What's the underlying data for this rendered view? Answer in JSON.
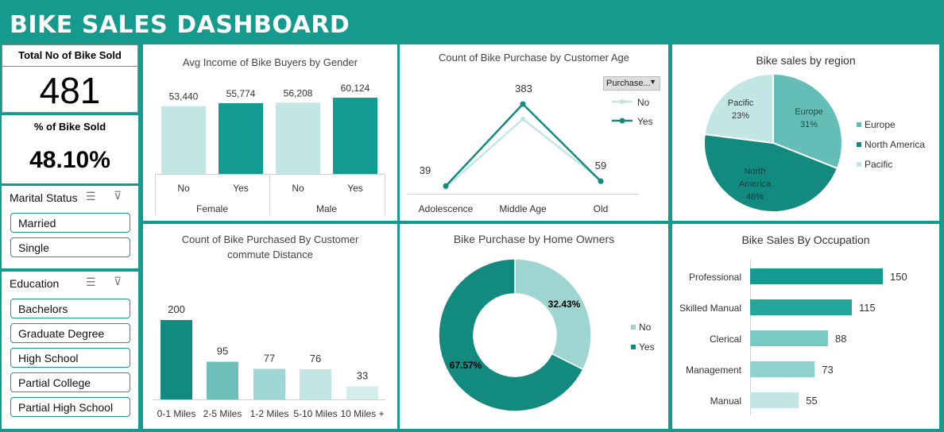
{
  "dashboard": {
    "title": "BIKE SALES DASHBOARD"
  },
  "kpis": {
    "total_label": "Total No of Bike Sold",
    "total_value": "481",
    "pct_label": "% of Bike Sold",
    "pct_value": "48.10%"
  },
  "slicers": {
    "marital": {
      "title": "Marital Status",
      "items": [
        "Married",
        "Single"
      ]
    },
    "education": {
      "title": "Education",
      "items": [
        "Bachelors",
        "Graduate Degree",
        "High School",
        "Partial College",
        "Partial High School"
      ]
    }
  },
  "colors": {
    "dark": "#138a80",
    "mid": "#79c6c1",
    "light": "#c2e6e4",
    "bg": "#159a8e"
  },
  "chart_data": [
    {
      "id": "income_gender",
      "type": "bar",
      "title": "Avg Income of Bike Buyers by  Gender",
      "groups": [
        "Female",
        "Male"
      ],
      "categories": [
        "No",
        "Yes",
        "No",
        "Yes"
      ],
      "values": [
        53440,
        55774,
        56208,
        60124
      ],
      "labels": [
        "53,440",
        "55,774",
        "56,208",
        "60,124"
      ]
    },
    {
      "id": "age",
      "type": "line",
      "title": "Count of Bike Purchase by Customer Age",
      "filter_label": "Purchase...",
      "categories": [
        "Adolescence",
        "Middle Age",
        "Old"
      ],
      "series": [
        {
          "name": "No",
          "values": [
            33,
            320,
            64
          ]
        },
        {
          "name": "Yes",
          "values": [
            39,
            383,
            59
          ]
        }
      ],
      "data_labels": [
        "39",
        "383",
        "59"
      ]
    },
    {
      "id": "region",
      "type": "pie",
      "title": "Bike sales by region",
      "slices": [
        {
          "name": "Europe",
          "value": 31,
          "label": "31%"
        },
        {
          "name": "North America",
          "value": 46,
          "label": "46%"
        },
        {
          "name": "Pacific",
          "value": 23,
          "label": "23%"
        }
      ],
      "legend": [
        "Europe",
        "North America",
        "Pacific"
      ]
    },
    {
      "id": "commute",
      "type": "bar",
      "title_line1": "Count of Bike Purchased By Customer",
      "title_line2": "commute Distance",
      "categories": [
        "0-1 Miles",
        "2-5 Miles",
        "1-2 Miles",
        "5-10 Miles",
        "10 Miles +"
      ],
      "values": [
        200,
        95,
        77,
        76,
        33
      ]
    },
    {
      "id": "home_owners",
      "type": "pie",
      "title": "Bike Purchase by Home Owners",
      "slices": [
        {
          "name": "No",
          "value": 32.43,
          "label": "32.43%"
        },
        {
          "name": "Yes",
          "value": 67.57,
          "label": "67.57%"
        }
      ],
      "legend": [
        "No",
        "Yes"
      ]
    },
    {
      "id": "occupation",
      "type": "bar",
      "title": "Bike Sales By Occupation",
      "categories": [
        "Professional",
        "Skilled Manual",
        "Clerical",
        "Management",
        "Manual"
      ],
      "values": [
        150,
        115,
        88,
        73,
        55
      ]
    }
  ]
}
